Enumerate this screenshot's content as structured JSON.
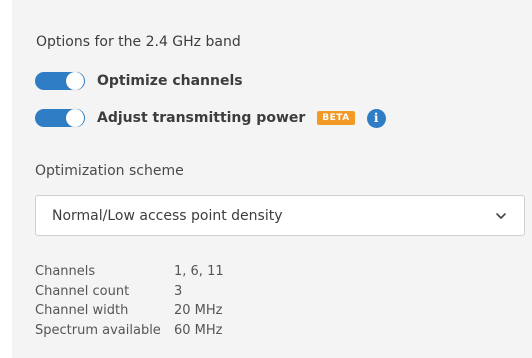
{
  "panel": {
    "title": "Options for the 2.4 GHz band"
  },
  "toggles": [
    {
      "label": "Optimize channels",
      "on": true
    },
    {
      "label": "Adjust transmitting power",
      "on": true,
      "badge": "BETA",
      "info_icon": "info-icon"
    }
  ],
  "scheme": {
    "label": "Optimization scheme",
    "selected": "Normal/Low access point density"
  },
  "details": [
    {
      "key": "Channels",
      "value": "1, 6, 11"
    },
    {
      "key": "Channel count",
      "value": "3"
    },
    {
      "key": "Channel width",
      "value": "20 MHz"
    },
    {
      "key": "Spectrum available",
      "value": "60 MHz"
    }
  ],
  "colors": {
    "accent": "#2f7dc4",
    "beta_badge": "#f39a26",
    "panel_bg": "#f4f4f4"
  }
}
